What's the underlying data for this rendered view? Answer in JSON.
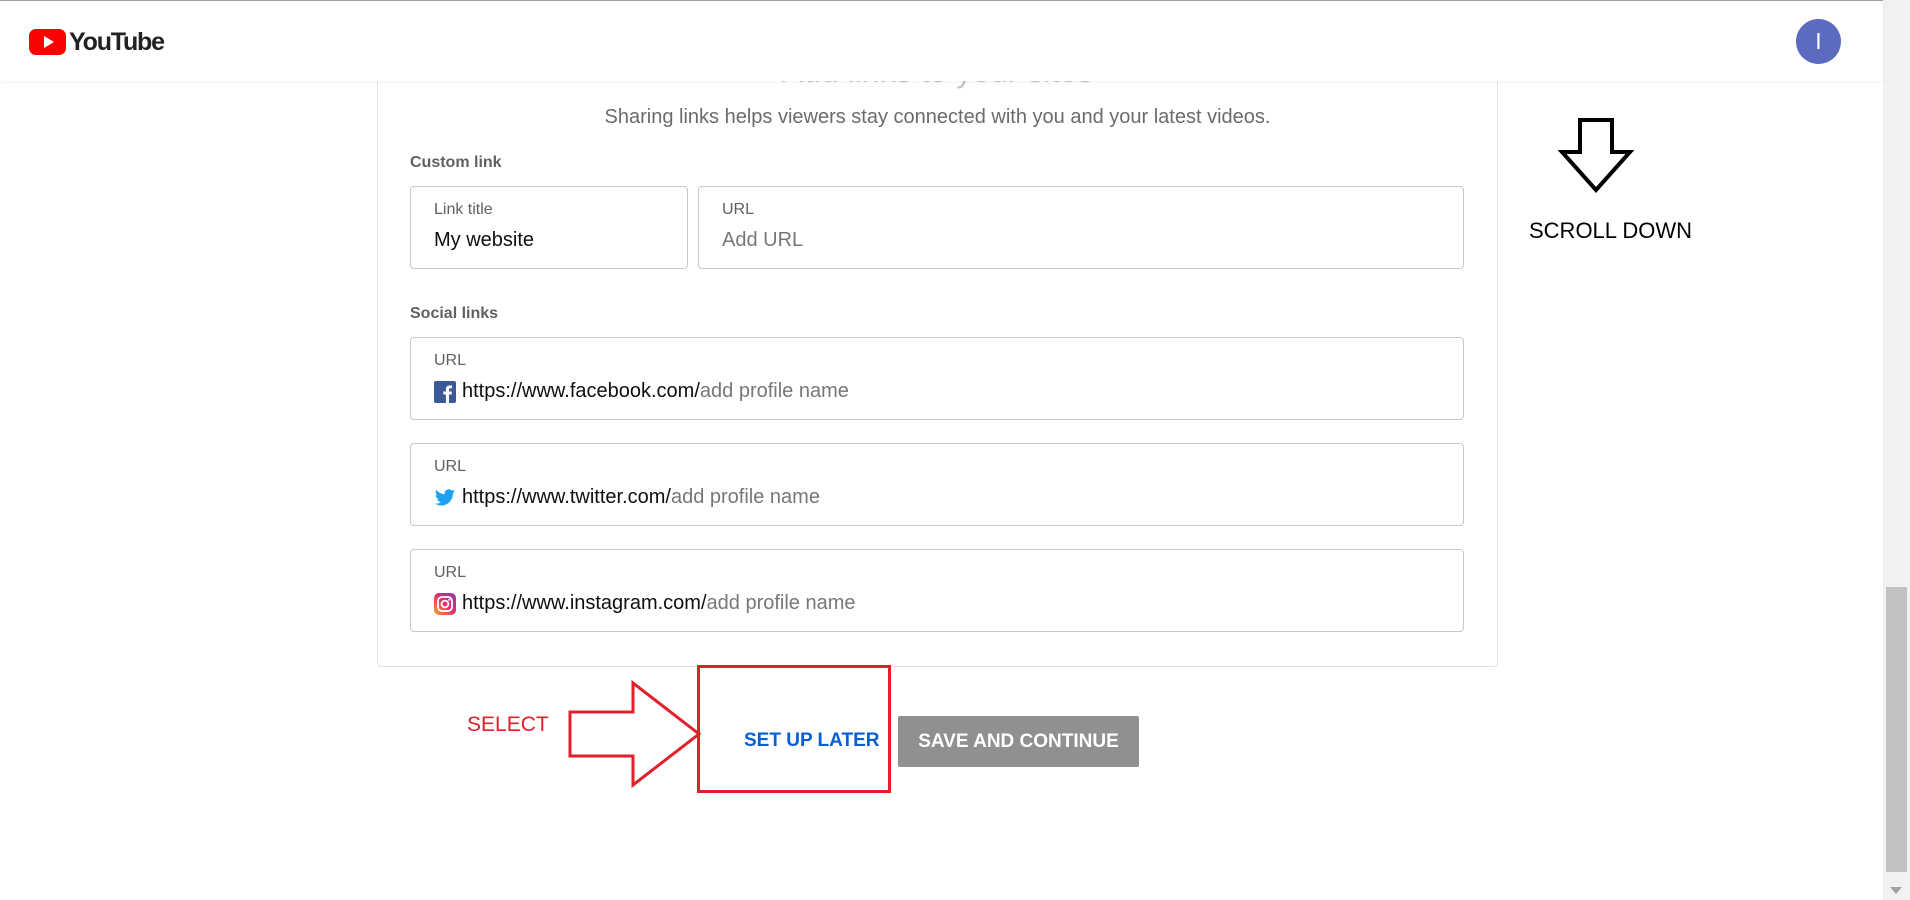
{
  "header": {
    "logo_text": "YouTube",
    "avatar_letter": "I",
    "brand_color": "#ff0000",
    "avatar_color": "#5c6bc0"
  },
  "card": {
    "title": "Add links to your sites",
    "subtitle": "Sharing links helps viewers stay connected with you and your latest videos.",
    "custom_link": {
      "section_label": "Custom link",
      "title_field": {
        "label": "Link title",
        "value": "My website"
      },
      "url_field": {
        "label": "URL",
        "placeholder": "Add URL"
      }
    },
    "social_links": {
      "section_label": "Social links",
      "items": [
        {
          "icon": "facebook-icon",
          "label": "URL",
          "prefix": "https://www.facebook.com/",
          "hint": "add profile name"
        },
        {
          "icon": "twitter-icon",
          "label": "URL",
          "prefix": "https://www.twitter.com/",
          "hint": "add profile name"
        },
        {
          "icon": "instagram-icon",
          "label": "URL",
          "prefix": "https://www.instagram.com/",
          "hint": "add profile name"
        }
      ]
    }
  },
  "actions": {
    "later_label": "SET UP LATER",
    "save_label": "SAVE AND CONTINUE",
    "link_color": "#065fd4",
    "disabled_color": "#909090"
  },
  "annotations": {
    "select_label": "SELECT",
    "scroll_label": "SCROLL DOWN",
    "highlight_color": "#e0202a"
  }
}
